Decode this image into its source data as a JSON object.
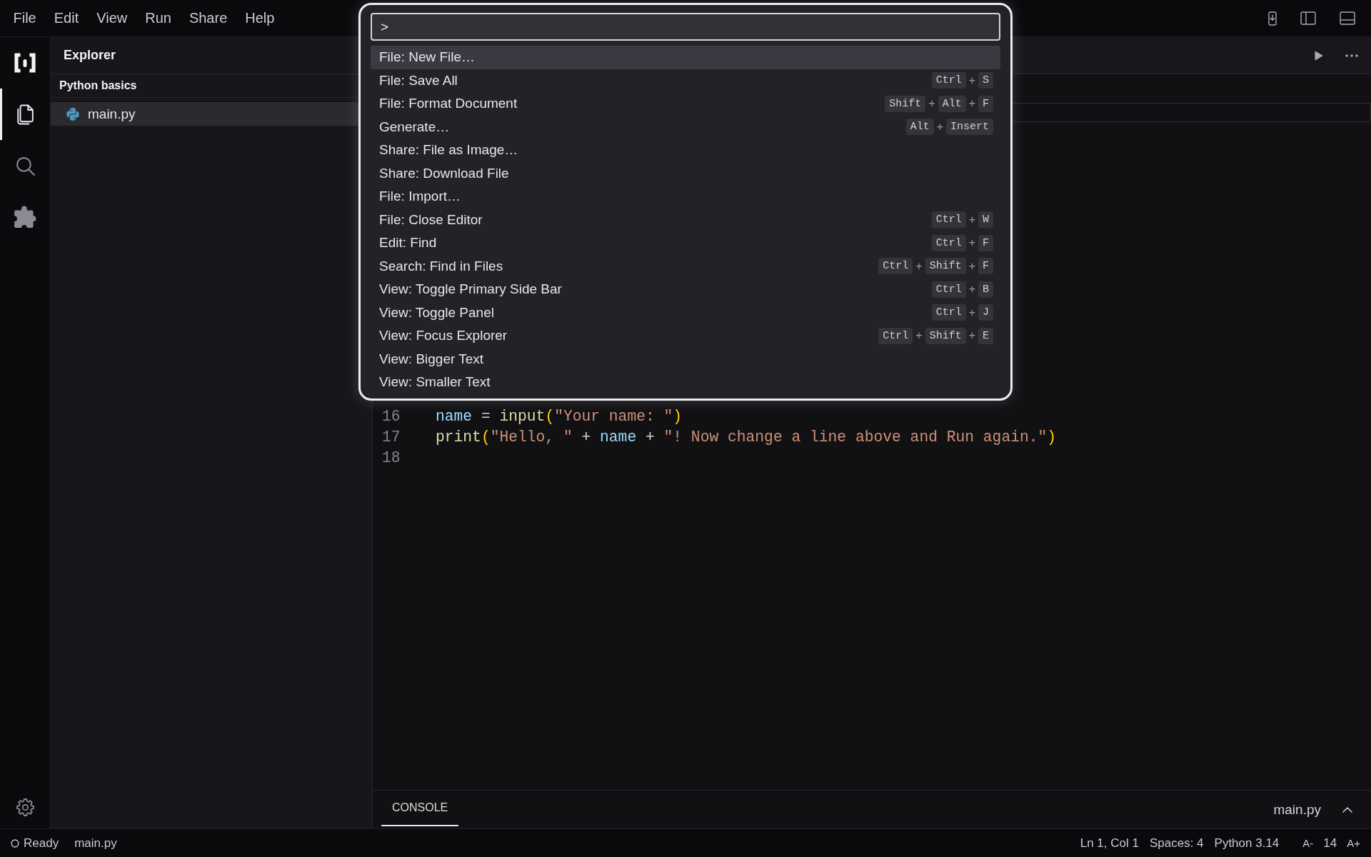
{
  "menu_bar": {
    "items": [
      "File",
      "Edit",
      "View",
      "Run",
      "Share",
      "Help"
    ]
  },
  "activity_bar": {
    "items": [
      {
        "kind": "files",
        "selected": true
      },
      {
        "kind": "search",
        "selected": false
      },
      {
        "kind": "extensions",
        "selected": false
      }
    ]
  },
  "sidebar": {
    "title": "Explorer",
    "sections": [
      {
        "title": "Python basics",
        "files": [
          {
            "name": "main.py",
            "selected": true
          }
        ]
      }
    ]
  },
  "command_palette": {
    "query": ">",
    "items": [
      {
        "label": "File: New File…",
        "selected": true
      },
      {
        "label": "File: Save All",
        "selected": false,
        "shortcut": [
          "Ctrl",
          "+",
          "S"
        ]
      },
      {
        "label": "File: Format Document",
        "selected": false,
        "shortcut": [
          "Shift",
          "+",
          "Alt",
          "+",
          "F"
        ]
      },
      {
        "label": "Generate…",
        "selected": false,
        "shortcut": [
          "Alt",
          "+",
          "Insert"
        ]
      },
      {
        "label": "Share: File as Image…",
        "selected": false
      },
      {
        "label": "Share: Download File",
        "selected": false
      },
      {
        "label": "File: Import…",
        "selected": false
      },
      {
        "label": "File: Close Editor",
        "selected": false,
        "shortcut": [
          "Ctrl",
          "+",
          "W"
        ]
      },
      {
        "label": "Edit: Find",
        "selected": false,
        "shortcut": [
          "Ctrl",
          "+",
          "F"
        ]
      },
      {
        "label": "Search: Find in Files",
        "selected": false,
        "shortcut": [
          "Ctrl",
          "+",
          "Shift",
          "+",
          "F"
        ]
      },
      {
        "label": "View: Toggle Primary Side Bar",
        "selected": false,
        "shortcut": [
          "Ctrl",
          "+",
          "B"
        ]
      },
      {
        "label": "View: Toggle Panel",
        "selected": false,
        "shortcut": [
          "Ctrl",
          "+",
          "J"
        ]
      },
      {
        "label": "View: Focus Explorer",
        "selected": false,
        "shortcut": [
          "Ctrl",
          "+",
          "Shift",
          "+",
          "E"
        ]
      },
      {
        "label": "View: Bigger Text",
        "selected": false
      },
      {
        "label": "View: Smaller Text",
        "selected": false
      }
    ]
  },
  "editor": {
    "lines": [
      {
        "number": "16",
        "tokens": [
          {
            "kind": "variable",
            "text": "name"
          },
          {
            "kind": "operator",
            "text": " = "
          },
          {
            "kind": "function",
            "text": "input"
          },
          {
            "kind": "bracket",
            "text": "("
          },
          {
            "kind": "string",
            "text": "\"Your name: \""
          },
          {
            "kind": "bracket",
            "text": ")"
          }
        ]
      },
      {
        "number": "17",
        "tokens": [
          {
            "kind": "function",
            "text": "print"
          },
          {
            "kind": "bracket",
            "text": "("
          },
          {
            "kind": "string",
            "text": "\"Hello, \""
          },
          {
            "kind": "operator",
            "text": " + "
          },
          {
            "kind": "variable",
            "text": "name"
          },
          {
            "kind": "operator",
            "text": " + "
          },
          {
            "kind": "string",
            "text": "\"! Now change a line above and Run again.\""
          },
          {
            "kind": "bracket",
            "text": ")"
          }
        ]
      },
      {
        "number": "18"
      }
    ]
  },
  "panel": {
    "tabs": [
      {
        "label": "CONSOLE",
        "selected": true
      }
    ],
    "file": "main.py"
  },
  "status_bar": {
    "state": "Ready",
    "file": "main.py",
    "cursor": "Ln 1, Col 1",
    "indentation": "Spaces: 4",
    "language": "Python 3.14",
    "font_smaller": "A-",
    "font_size": "14",
    "font_larger": "A+"
  }
}
